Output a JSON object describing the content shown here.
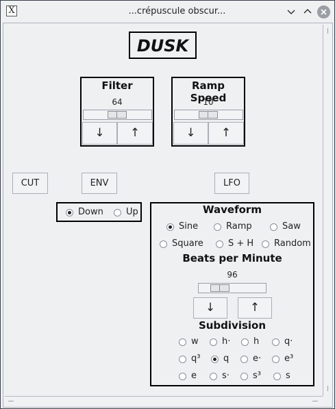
{
  "window": {
    "title": "...crépuscule obscur..."
  },
  "app_title": "DUSK",
  "filter": {
    "label": "Filter",
    "value": "64",
    "level": 0.5,
    "down": "↓",
    "up": "↑"
  },
  "ramp_speed": {
    "label": "Ramp Speed",
    "value": "10",
    "level": 0.5,
    "down": "↓",
    "up": "↑"
  },
  "buttons": {
    "cut": "CUT",
    "env": "ENV",
    "lfo": "LFO"
  },
  "direction": {
    "options": [
      "Down",
      "Up"
    ],
    "selected": "Down"
  },
  "waveform": {
    "label": "Waveform",
    "options": [
      "Sine",
      "Ramp",
      "Saw",
      "Square",
      "S + H",
      "Random"
    ],
    "selected": "Sine"
  },
  "bpm": {
    "label": "Beats per Minute",
    "value": "96",
    "level": 0.3,
    "down": "↓",
    "up": "↑"
  },
  "subdivision": {
    "label": "Subdivision",
    "options": [
      "w",
      "h·",
      "h",
      "q·",
      "q³",
      "q",
      "e·",
      "e³",
      "e",
      "s·",
      "s³",
      "s"
    ],
    "selected": "q"
  },
  "icons": [
    "app-x-icon",
    "chevron-down-icon",
    "chevron-up-icon",
    "close-icon",
    "arrow-down-icon",
    "arrow-up-icon"
  ]
}
